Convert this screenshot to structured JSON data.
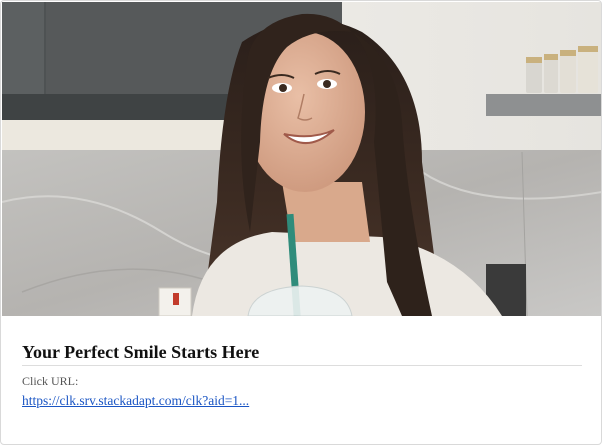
{
  "ad": {
    "image_alt": "Smiling woman in kitchen holding a drink",
    "title": "Your Perfect Smile Starts Here",
    "click_label": "Click URL:",
    "click_url": "https://clk.srv.stackadapt.com/clk?aid=1..."
  },
  "colors": {
    "link": "#1a55c4",
    "title": "#111111",
    "label": "#555555",
    "border": "#d9d9d9"
  }
}
